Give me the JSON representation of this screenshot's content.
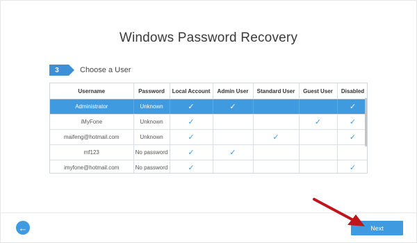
{
  "page": {
    "title": "Windows Password Recovery"
  },
  "step": {
    "number": "3",
    "label": "Choose a User"
  },
  "table": {
    "columns": [
      "Username",
      "Password",
      "Local Account",
      "Admin User",
      "Standard User",
      "Guest User",
      "Disabled"
    ],
    "check_glyph": "✓",
    "rows": [
      {
        "username": "Administrator",
        "password": "Unknown",
        "local": true,
        "admin": true,
        "standard": false,
        "guest": false,
        "disabled": true,
        "selected": true
      },
      {
        "username": "iMyFone",
        "password": "Unknown",
        "local": true,
        "admin": false,
        "standard": false,
        "guest": true,
        "disabled": true,
        "selected": false
      },
      {
        "username": "maifeng@hotmail.com",
        "password": "Unknown",
        "local": true,
        "admin": false,
        "standard": true,
        "guest": false,
        "disabled": true,
        "selected": false
      },
      {
        "username": "mf123",
        "password": "No password",
        "local": true,
        "admin": true,
        "standard": false,
        "guest": false,
        "disabled": false,
        "selected": false
      },
      {
        "username": "imyfone@hotmail.com",
        "password": "No password",
        "local": true,
        "admin": false,
        "standard": false,
        "guest": false,
        "disabled": true,
        "selected": false
      }
    ]
  },
  "footer": {
    "back_icon": "arrow-left-icon",
    "next_label": "Next"
  },
  "colors": {
    "accent": "#3f9ae0",
    "annotation_arrow": "#c0141c"
  }
}
